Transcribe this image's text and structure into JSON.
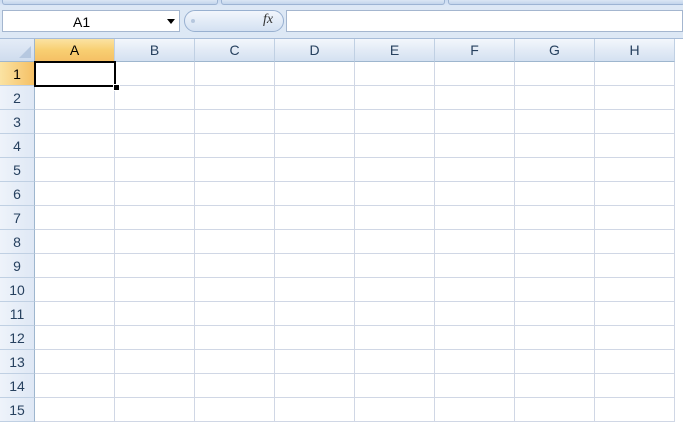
{
  "formula_bar": {
    "name_box_value": "A1",
    "fx_label": "fx",
    "formula_value": ""
  },
  "sheet": {
    "columns": [
      "A",
      "B",
      "C",
      "D",
      "E",
      "F",
      "G",
      "H"
    ],
    "rows": [
      "1",
      "2",
      "3",
      "4",
      "5",
      "6",
      "7",
      "8",
      "9",
      "10",
      "11",
      "12",
      "13",
      "14",
      "15"
    ],
    "active_column": "A",
    "active_row": "1"
  },
  "colors": {
    "active_header": "#f8cf72",
    "header_bg": "#e3ebf6",
    "gridline": "#d0d7e5"
  }
}
